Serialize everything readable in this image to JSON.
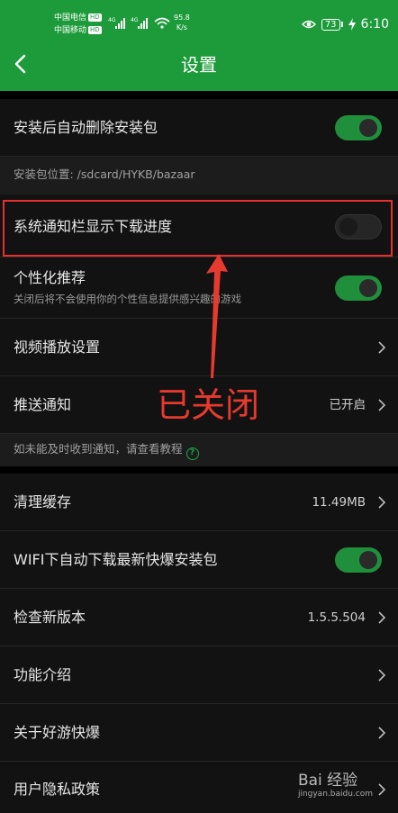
{
  "status_bar": {
    "carrier_1": "中国电信",
    "carrier_2": "中国移动",
    "hd_badge": "HD",
    "net_type": "4G",
    "speed_value": "95.8",
    "speed_unit": "K/s",
    "battery": "73",
    "time": "6:10"
  },
  "header": {
    "title": "设置",
    "back_icon": "chevron-left-icon",
    "bg_color": "#1d9b3a"
  },
  "settings": {
    "auto_delete": {
      "label": "安装后自动删除安装包",
      "enabled": true
    },
    "package_location": "安装包位置: /sdcard/HYKB/bazaar",
    "notify_progress": {
      "label": "系统通知栏显示下载进度",
      "enabled": false
    },
    "personalized": {
      "label": "个性化推荐",
      "sub": "关闭后将不会使用你的个性信息提供感兴趣的游戏",
      "enabled": true
    },
    "video_playback": {
      "label": "视频播放设置"
    },
    "push": {
      "label": "推送通知",
      "value": "已开启"
    },
    "push_note": "如未能及时收到通知，请查看教程",
    "cache": {
      "label": "清理缓存",
      "value": "11.49MB"
    },
    "wifi_auto": {
      "label": "WIFI下自动下载最新快爆安装包",
      "enabled": true
    },
    "check_update": {
      "label": "检查新版本",
      "value": "1.5.5.504"
    },
    "features": {
      "label": "功能介绍"
    },
    "about": {
      "label": "关于好游快爆"
    },
    "privacy": {
      "label": "用户隐私政策"
    }
  },
  "annotation": {
    "text": "已关闭",
    "color": "#e63a2f"
  },
  "watermark": {
    "brand": "Bai 经验",
    "url": "jingyan.baidu.com"
  }
}
